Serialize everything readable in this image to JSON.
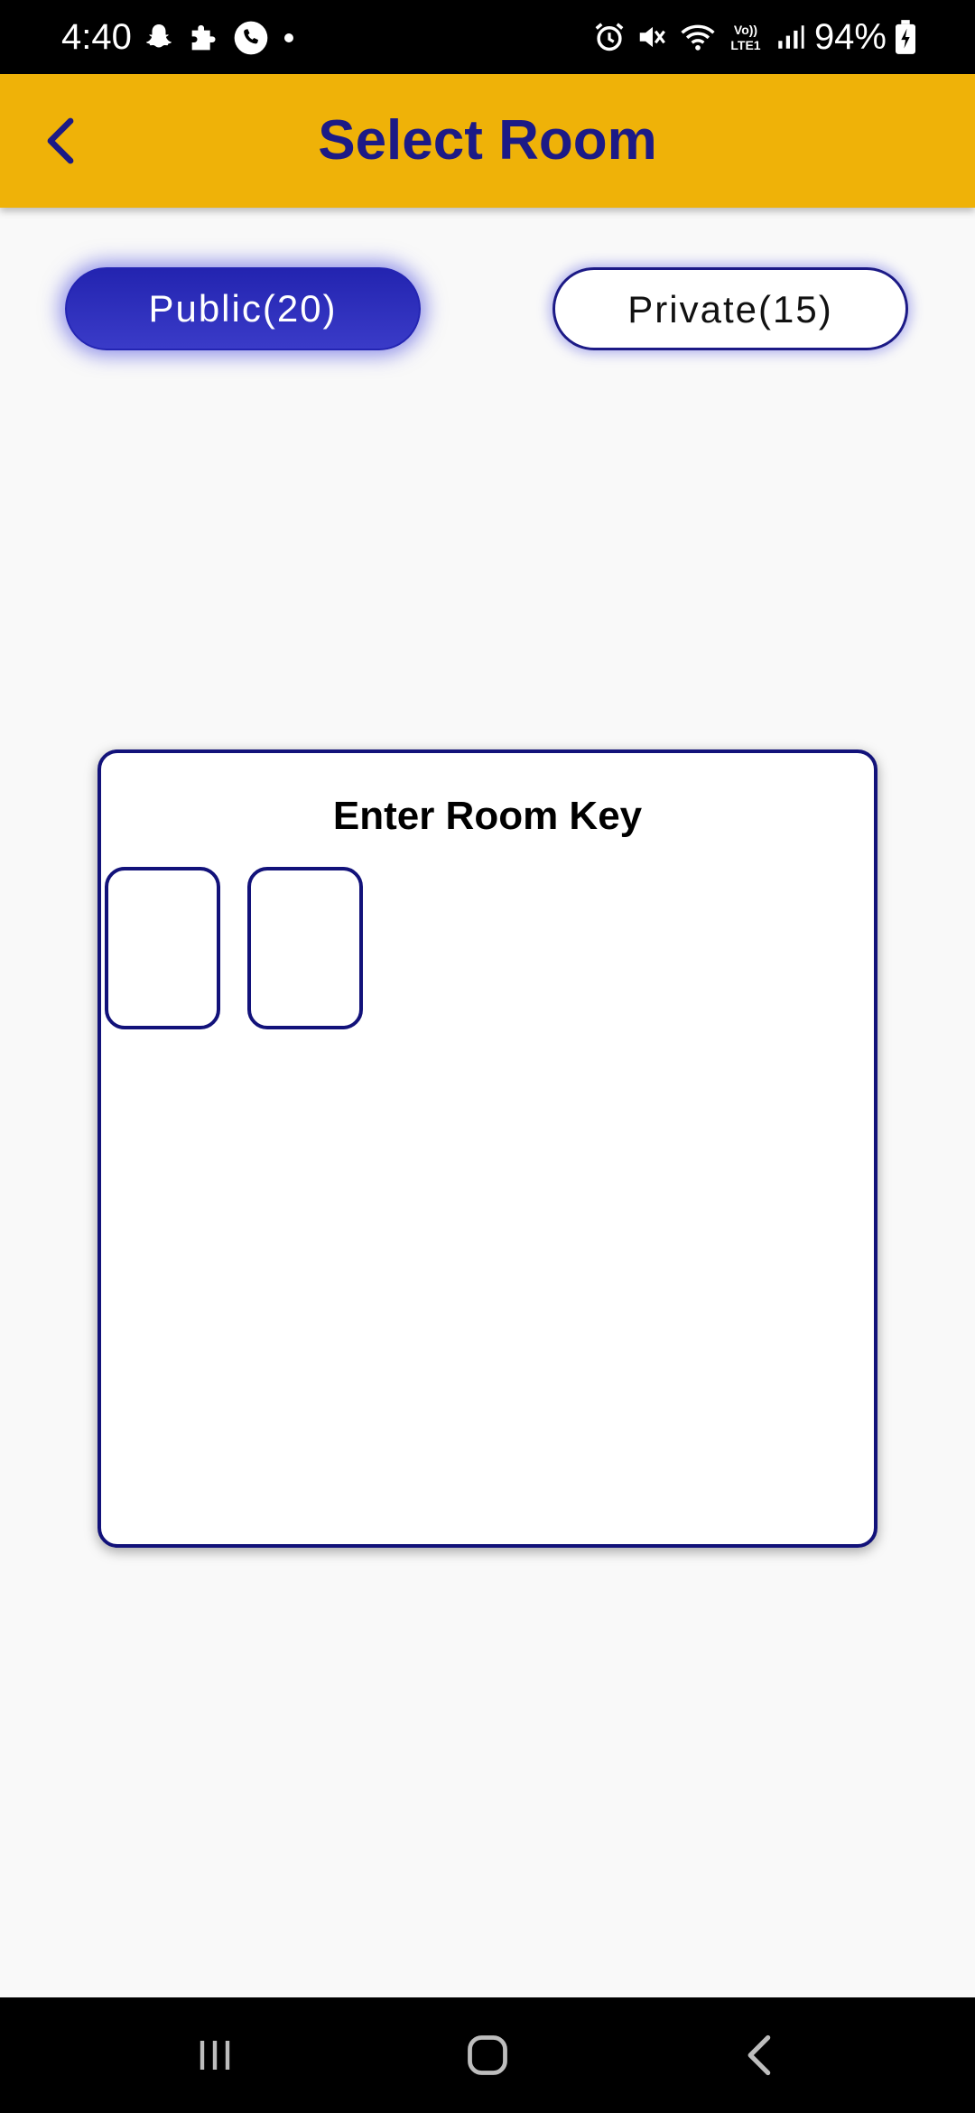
{
  "status_bar": {
    "time": "4:40",
    "left_icons": [
      "snapchat-icon",
      "puzzle-icon",
      "phone-call-icon",
      "dot-icon"
    ],
    "right_icons": [
      "alarm-icon",
      "mute-icon",
      "wifi-icon",
      "volte-icon",
      "signal-icon"
    ],
    "volte_text": "Vo))\nLTE1",
    "battery_text": "94%",
    "battery_icon": "battery-charging-icon"
  },
  "app_bar": {
    "title": "Select Room",
    "back_icon": "chevron-left-icon",
    "background_color": "#efb208",
    "title_color": "#1c1a86"
  },
  "tabs": [
    {
      "label": "Public(20)",
      "selected": true
    },
    {
      "label": "Private(15)",
      "selected": false
    }
  ],
  "room_key_card": {
    "title": "Enter Room Key",
    "inputs": [
      {
        "value": ""
      },
      {
        "value": ""
      }
    ]
  },
  "nav_bar": {
    "buttons": [
      "recents-icon",
      "home-icon",
      "back-icon"
    ]
  },
  "colors": {
    "accent_blue": "#2324b0",
    "border_navy": "#12127a",
    "page_background": "#f9f9f9"
  }
}
